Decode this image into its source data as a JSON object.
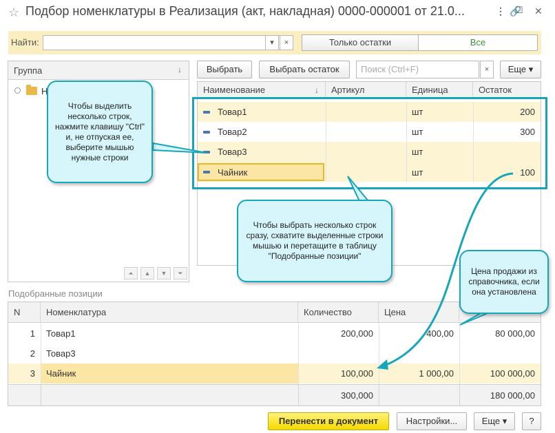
{
  "window": {
    "title": "Подбор номенклатуры в Реализация (акт, накладная) 0000-000001 от 21.0...",
    "controls": {
      "link": "🔗",
      "more": "⋮",
      "maximize": "☐",
      "close": "✕"
    }
  },
  "search": {
    "label": "Найти:",
    "value": "",
    "dropdown_icon": "▾",
    "clear_icon": "×",
    "seg_remaining": "Только остатки",
    "seg_all": "Все"
  },
  "group_panel": {
    "header": "Группа",
    "sort_icon": "↓",
    "tree_item": "Н",
    "nav_icons": [
      "⏶",
      "▲",
      "▼",
      "⏷"
    ]
  },
  "toolbar": {
    "select_label": "Выбрать",
    "select_rest_label": "Выбрать остаток",
    "search_placeholder": "Поиск (Ctrl+F)",
    "clear_icon": "×",
    "more_label": "Еще ▾"
  },
  "items": {
    "columns": [
      "Наименование",
      "Артикул",
      "Единица",
      "Остаток"
    ],
    "sort_icon": "↓",
    "rows": [
      {
        "name": "Товар1",
        "article": "",
        "unit": "шт",
        "rest": "200"
      },
      {
        "name": "Товар2",
        "article": "",
        "unit": "шт",
        "rest": "300"
      },
      {
        "name": "Товар3",
        "article": "",
        "unit": "шт",
        "rest": ""
      },
      {
        "name": "Чайник",
        "article": "",
        "unit": "шт",
        "rest": "100"
      }
    ]
  },
  "callouts": {
    "ctrl_hint": "Чтобы выделить несколько строк, нажмите клавишу \"Ctrl\" и, не отпуская ее, выберите мышью нужные строки",
    "drag_hint": "Чтобы выбрать несколько строк сразу, схватите выделенные строки мышью и перетащите в таблицу \"Подобранные позиции\"",
    "price_hint": "Цена продажи из справочника, если она установлена"
  },
  "selected": {
    "section_label": "Подобранные позиции",
    "columns": [
      "N",
      "Номенклатура",
      "Количество",
      "Цена",
      ""
    ],
    "rows": [
      {
        "n": "1",
        "name": "Товар1",
        "qty": "200,000",
        "price": "400,00",
        "sum": "80 000,00"
      },
      {
        "n": "2",
        "name": "Товар3",
        "qty": "",
        "price": "",
        "sum": ""
      },
      {
        "n": "3",
        "name": "Чайник",
        "qty": "100,000",
        "price": "1 000,00",
        "sum": "100 000,00"
      }
    ],
    "totals": {
      "qty": "300,000",
      "sum": "180 000,00"
    }
  },
  "footer": {
    "transfer_label": "Перенести в документ",
    "settings_label": "Настройки...",
    "more_label": "Еще ▾",
    "help_label": "?"
  },
  "colors": {
    "accent_teal": "#17a6b9",
    "highlight_yellow": "#fdf4d4",
    "primary_yellow": "#f5d900"
  }
}
